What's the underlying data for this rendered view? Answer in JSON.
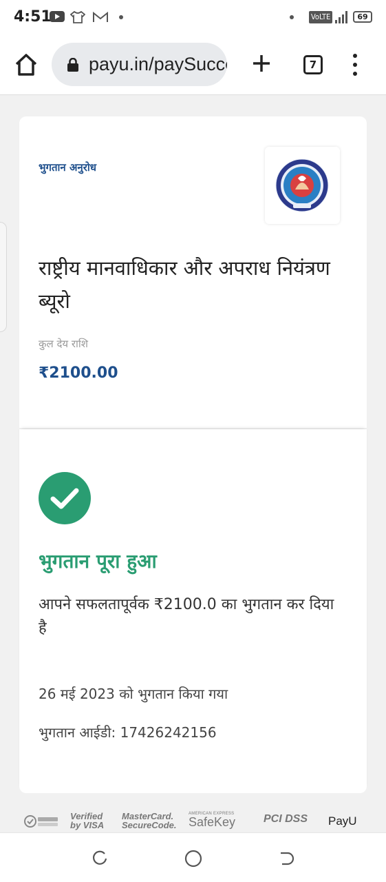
{
  "status_bar": {
    "time": "4:51",
    "volte": "VoLTE",
    "battery": "69",
    "icons": [
      "youtube-icon",
      "shirt-icon",
      "gmail-icon",
      "notification-dot-icon",
      "signal-icon",
      "battery-icon"
    ]
  },
  "browser": {
    "url": "payu.in/paySuccess",
    "tab_count": "7",
    "icons": [
      "home-icon",
      "lock-icon",
      "plus-icon",
      "tabs-icon",
      "more-vert-icon"
    ]
  },
  "merchant": {
    "request_label": "भुगतान अनुरोध",
    "name": "राष्ट्रीय मानवाधिकार और अपराध नियंत्रण ब्यूरो",
    "amount_label": "कुल देय राशि",
    "amount": "₹2100.00"
  },
  "payment": {
    "title": "भुगतान पूरा हुआ",
    "message": "आपने सफलतापूर्वक ₹2100.0 का भुगतान कर दिया है",
    "paid_date": "26 मई 2023 को भुगतान किया गया",
    "txn_id": "भुगतान आईडी: 17426242156"
  },
  "footer": {
    "visa": "Verified by VISA",
    "mastercard": "MasterCard. SecureCode.",
    "amex_top": "AMERICAN EXPRESS",
    "safekey": "SafeKey",
    "pci": "PCI DSS",
    "payu": "PayU"
  },
  "colors": {
    "accent_blue": "#1e4f8c",
    "success_green": "#2a9d72",
    "background": "#f1f1f1"
  }
}
